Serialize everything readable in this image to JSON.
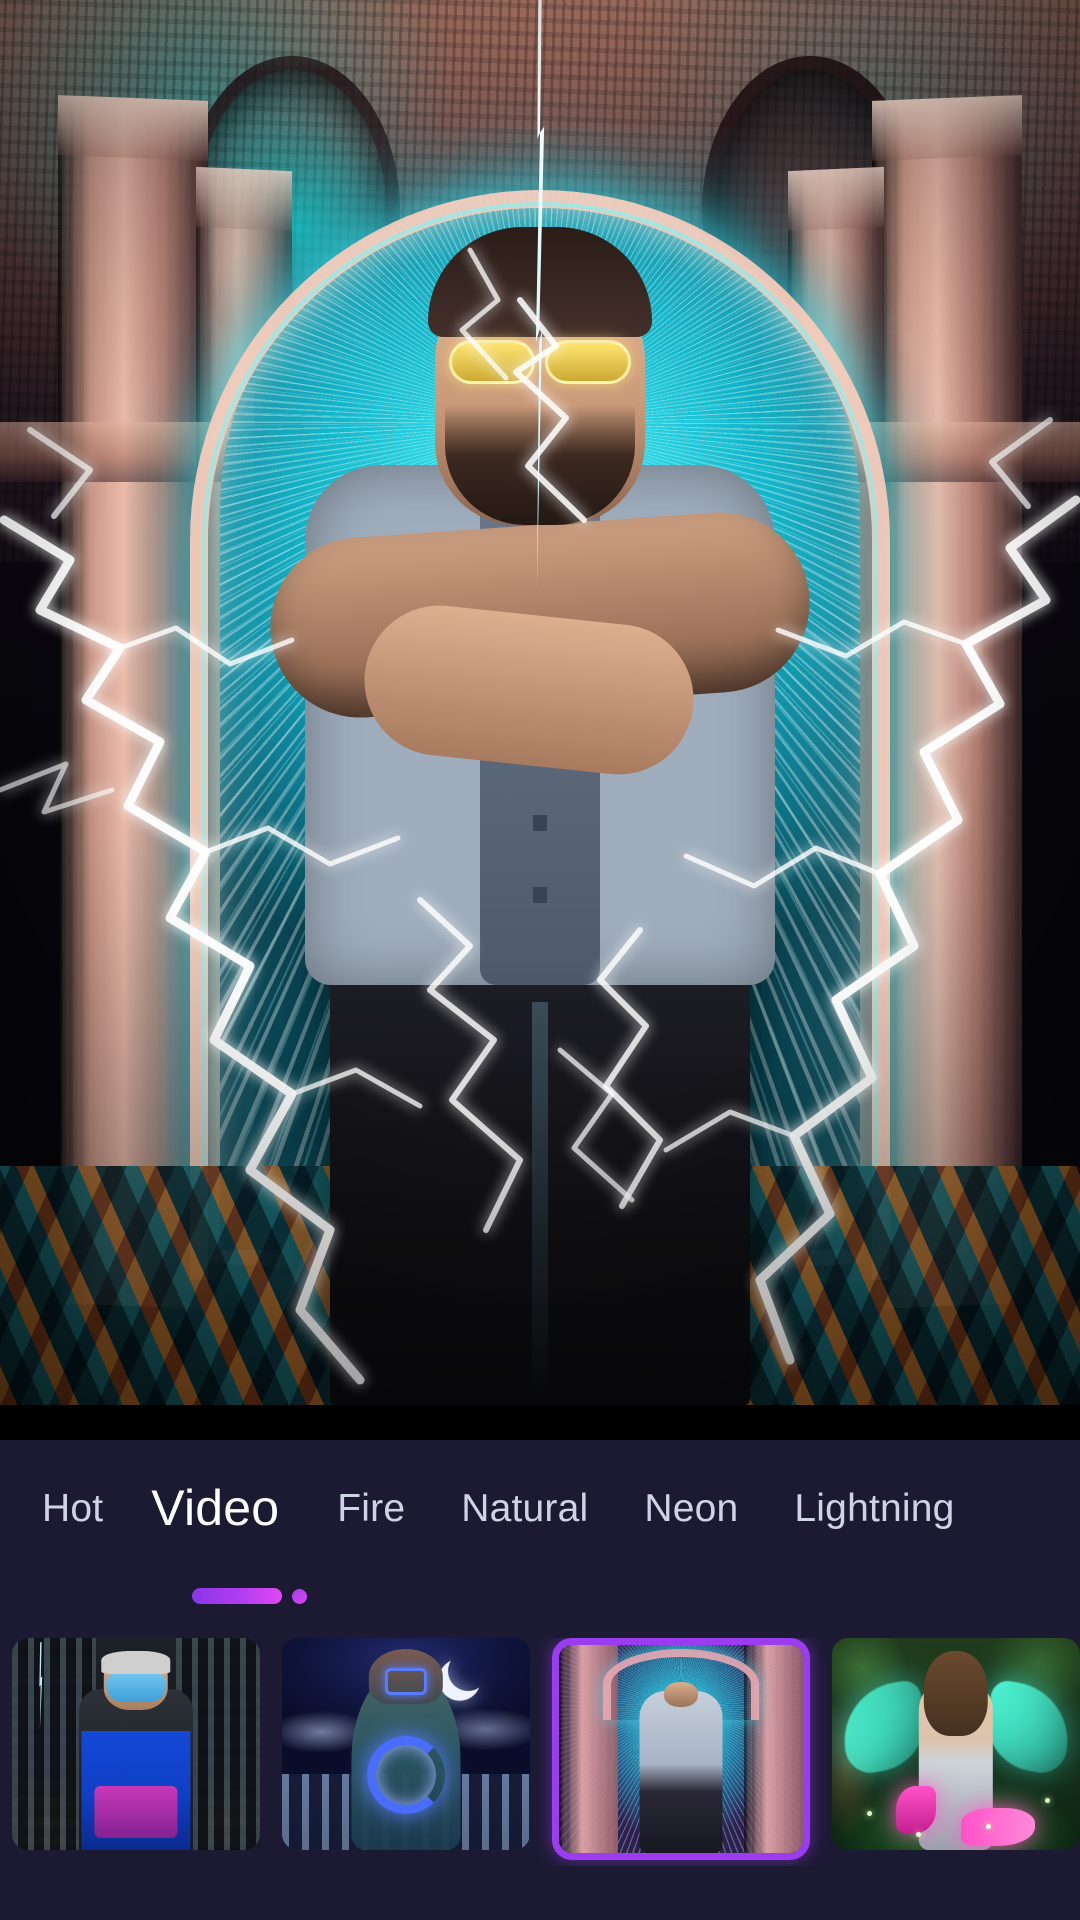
{
  "app": {
    "screen_name": "effect-picker",
    "theme": {
      "panel_bg": "#1C1A33",
      "active_tab_color": "#FFFFFF",
      "inactive_tab_color": "#CFD4E4",
      "accent_purple": "#9B3CF0",
      "indicator_gradient_start": "#8A36E8",
      "indicator_gradient_end": "#E248F5"
    }
  },
  "preview": {
    "name": "effect-preview",
    "description": "Man with yellow sunglasses and denim jacket standing under a glowing teal archway with white lightning bolts",
    "alt": "lightning effect preview"
  },
  "tabs": {
    "active_index": 1,
    "items": [
      {
        "label": "Hot",
        "active": false
      },
      {
        "label": "Video",
        "active": true
      },
      {
        "label": "Fire",
        "active": false
      },
      {
        "label": "Natural",
        "active": false
      },
      {
        "label": "Neon",
        "active": false
      },
      {
        "label": "Lightning",
        "active": false
      }
    ]
  },
  "page_indicator": {
    "name": "page-indicator",
    "pages": 2,
    "current": 1
  },
  "thumbnails": {
    "selected_index": 2,
    "items": [
      {
        "name": "thumb-masked-city",
        "label": "",
        "selected": false
      },
      {
        "name": "thumb-hooded-neon",
        "label": "",
        "selected": false
      },
      {
        "name": "thumb-arch-lightning",
        "label": "",
        "selected": true
      },
      {
        "name": "thumb-angel-wings",
        "label": "",
        "selected": false
      }
    ]
  }
}
